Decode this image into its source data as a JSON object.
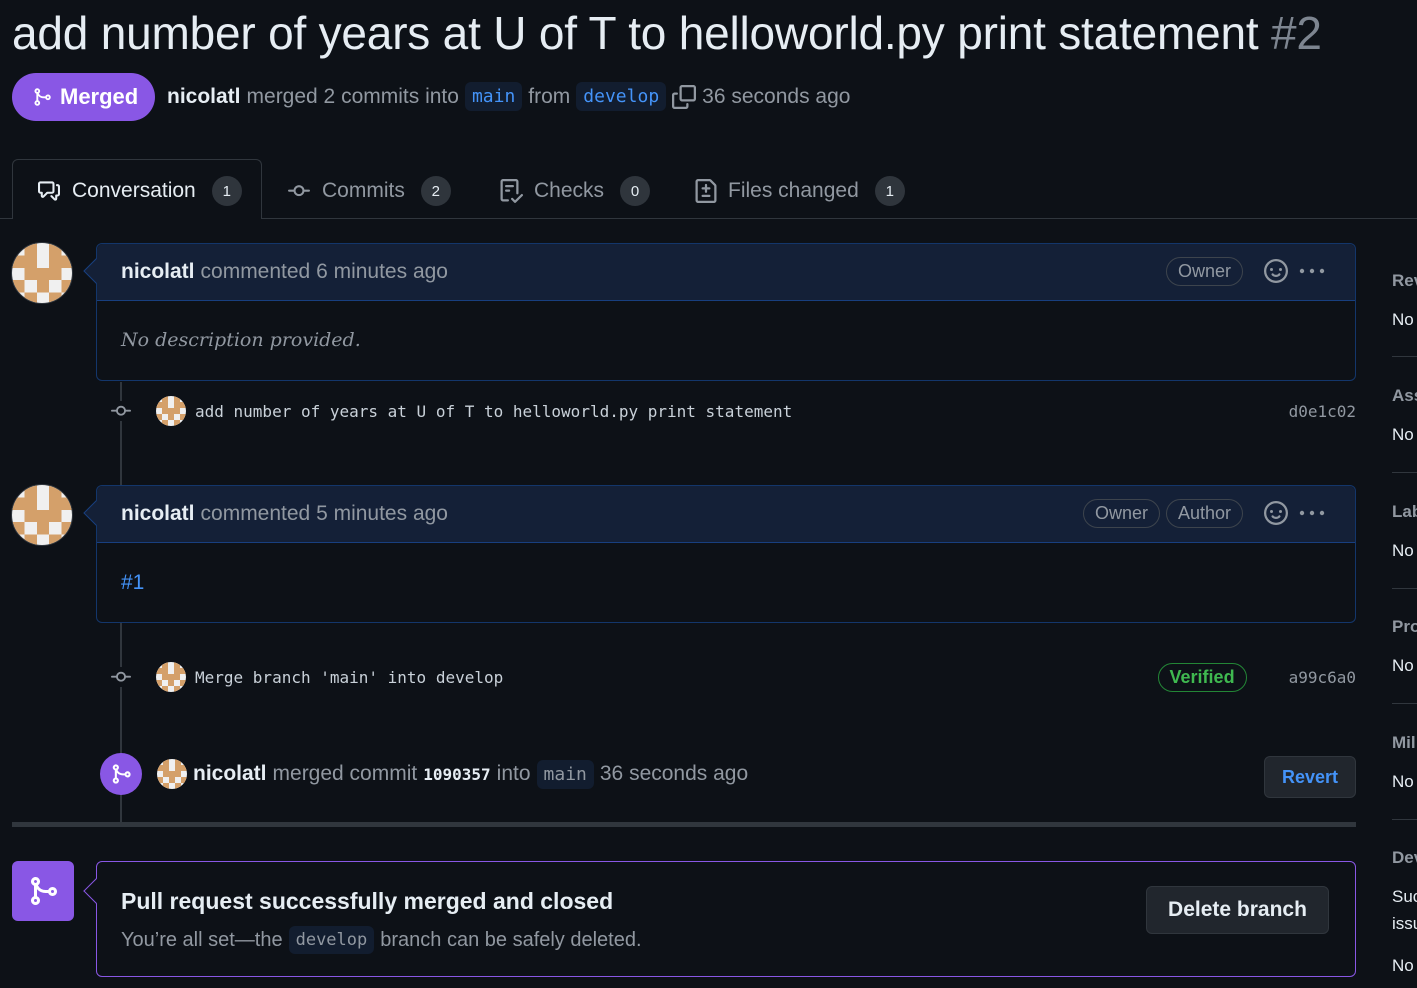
{
  "pr": {
    "title": "add number of years at U of T to helloworld.py print statement",
    "number": "#2",
    "state": "Merged",
    "author": "nicolatl",
    "merged_text": "merged 2 commits into",
    "base_branch": "main",
    "from_text": "from",
    "head_branch": "develop",
    "time": "36 seconds ago"
  },
  "tabs": [
    {
      "label": "Conversation",
      "count": "1",
      "icon": "comment-discussion-icon"
    },
    {
      "label": "Commits",
      "count": "2",
      "icon": "git-commit-icon"
    },
    {
      "label": "Checks",
      "count": "0",
      "icon": "checklist-icon"
    },
    {
      "label": "Files changed",
      "count": "1",
      "icon": "file-diff-icon"
    }
  ],
  "comments": [
    {
      "author": "nicolatl",
      "meta": "commented 6 minutes ago",
      "labels": [
        "Owner"
      ],
      "body": "No description provided."
    },
    {
      "author": "nicolatl",
      "meta": "commented 5 minutes ago",
      "labels": [
        "Owner",
        "Author"
      ],
      "body": "#1"
    }
  ],
  "commits": [
    {
      "message": "add number of years at U of T to helloworld.py print statement",
      "sha": "d0e1c02"
    },
    {
      "message": "Merge branch 'main' into develop",
      "sha": "a99c6a0",
      "verified": "Verified"
    }
  ],
  "merge_event": {
    "author": "nicolatl",
    "text": "merged commit",
    "commit": "1090357",
    "into": "into",
    "branch": "main",
    "time": "36 seconds ago",
    "revert_label": "Revert"
  },
  "merged_box": {
    "title": "Pull request successfully merged and closed",
    "text_before": "You’re all set—the",
    "branch": "develop",
    "text_after": "branch can be safely deleted.",
    "delete_label": "Delete branch"
  },
  "sidebar": {
    "sections": [
      {
        "head": "Rev",
        "value": "No"
      },
      {
        "head": "Ass",
        "value": "No"
      },
      {
        "head": "Lab",
        "value": "No"
      },
      {
        "head": "Pro",
        "value": "No"
      },
      {
        "head": "Mil",
        "value": "No"
      },
      {
        "head": "Dev",
        "value": "Suc",
        "value2": "issu",
        "value3": "No"
      }
    ]
  },
  "colors": {
    "merged_purple": "#8957e5",
    "link_blue": "#4493f8",
    "verified_green": "#3fb950",
    "background": "#0d1117"
  }
}
